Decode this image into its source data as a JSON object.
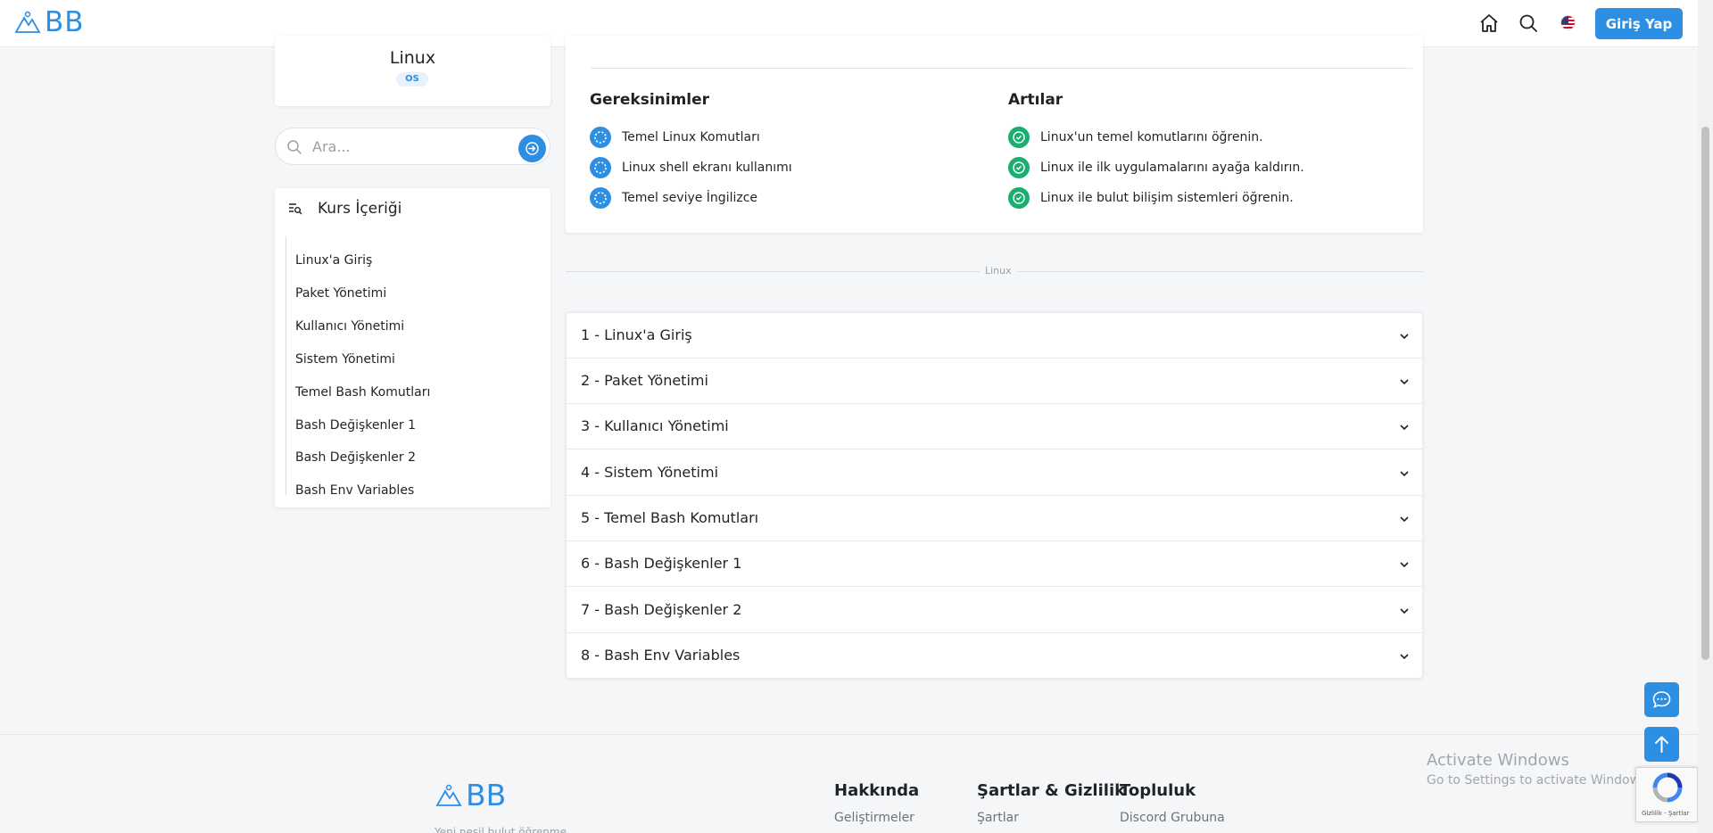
{
  "header": {
    "logo_text": "BB",
    "login_label": "Giriş Yap",
    "icons": [
      "home-icon",
      "search-icon",
      "flag-us-icon"
    ]
  },
  "course": {
    "title": "Linux",
    "badge": "OS"
  },
  "search": {
    "placeholder": "Ara..."
  },
  "course_content": {
    "heading": "Kurs İçeriği",
    "items": [
      "Linux'a Giriş",
      "Paket Yönetimi",
      "Kullanıcı Yönetimi",
      "Sistem Yönetimi",
      "Temel Bash Komutları",
      "Bash Değişkenler 1",
      "Bash Değişkenler 2",
      "Bash Env Variables"
    ]
  },
  "requirements": {
    "title": "Gereksinimler",
    "items": [
      "Temel Linux Komutları",
      "Linux shell ekranı kullanımı",
      "Temel seviye İngilizce"
    ]
  },
  "benefits": {
    "title": "Artılar",
    "items": [
      "Linux'un temel komutlarını öğrenin.",
      "Linux ile ilk uygulamalarını ayağa kaldırın.",
      "Linux ile bulut bilişim sistemleri öğrenin."
    ]
  },
  "divider_label": "Linux",
  "sections": [
    "1 - Linux'a Giriş",
    "2 - Paket Yönetimi",
    "3 - Kullanıcı Yönetimi",
    "4 - Sistem Yönetimi",
    "5 - Temel Bash Komutları",
    "6 - Bash Değişkenler 1",
    "7 - Bash Değişkenler 2",
    "8 - Bash Env Variables"
  ],
  "footer": {
    "logo_text": "BB",
    "tagline": "Yeni nesil bulut öğrenme",
    "columns": [
      {
        "title": "Hakkında",
        "link": "Geliştirmeler"
      },
      {
        "title": "Şartlar & Gizlilik",
        "link": "Şartlar"
      },
      {
        "title": "Topluluk",
        "link": "Discord Grubuna"
      }
    ]
  },
  "windows_watermark": {
    "line1": "Activate Windows",
    "line2": "Go to Settings to activate Windows."
  },
  "recaptcha_text": "Gizlilik - Şartlar",
  "colors": {
    "accent": "#2d8fe3",
    "success": "#1aae6f",
    "background": "#f5f6f8"
  }
}
